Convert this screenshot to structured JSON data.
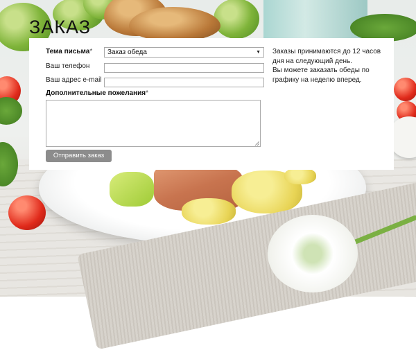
{
  "page": {
    "title": "ЗАКАЗ"
  },
  "form": {
    "subject_label": "Тема письма",
    "required_mark": "*",
    "subject_value": "Заказ обеда",
    "phone_label": "Ваш телефон",
    "phone_value": "",
    "email_label": "Ваш адрес e-mail",
    "email_value": "",
    "wishes_label": "Дополнительные пожелания",
    "wishes_value": "",
    "submit_label": "Отправить заказ"
  },
  "info": {
    "line1": "Заказы принимаются до 12 часов дня на следующий день.",
    "line2": "Вы можете заказать обеды по графику на неделю вперед."
  },
  "icons": {
    "select_arrow": "chevron-down-icon"
  },
  "colors": {
    "panel": "#ffffff",
    "button": "#8c8c8c",
    "title": "#111111"
  }
}
